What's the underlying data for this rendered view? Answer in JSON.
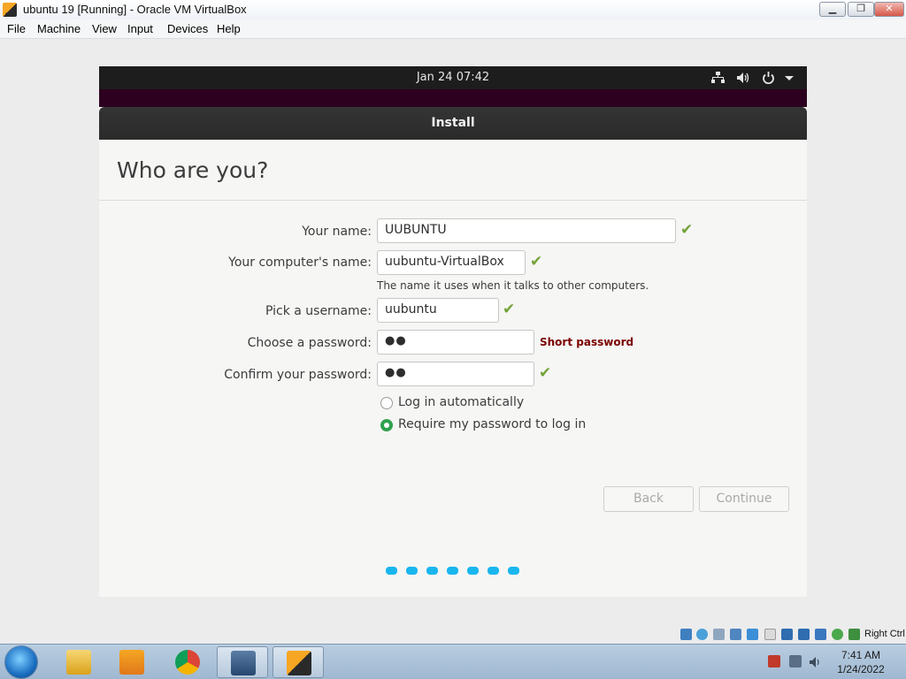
{
  "window": {
    "title": "ubuntu 19 [Running] - Oracle VM VirtualBox",
    "buttons": {
      "minimize": "▁",
      "maximize": "❐",
      "close": "✕"
    }
  },
  "menu": [
    "File",
    "Machine",
    "View",
    "Input",
    "Devices",
    "Help"
  ],
  "guest": {
    "top_bar": {
      "clock": "Jan 24  07:42",
      "icons": [
        "network-icon",
        "volume-icon",
        "power-icon",
        "dropdown-arrow-icon"
      ]
    },
    "installer": {
      "header": "Install",
      "page_title": "Who are you?",
      "fields": {
        "name": {
          "label": "Your name:",
          "value": "UUBUNTU"
        },
        "computer_name": {
          "label": "Your computer's name:",
          "value": "uubuntu-VirtualBox",
          "hint": "The name it uses when it talks to other computers."
        },
        "username": {
          "label": "Pick a username:",
          "value": "uubuntu"
        },
        "password": {
          "label": "Choose a password:",
          "value": "●●",
          "warning": "Short password"
        },
        "confirm_password": {
          "label": "Confirm your password:",
          "value": "●●"
        }
      },
      "login_options": {
        "auto": "Log in automatically",
        "require_password": "Require my password to log in",
        "selected": "require_password"
      },
      "buttons": {
        "back": "Back",
        "continue": "Continue"
      },
      "progress": {
        "steps": 7,
        "accent": "#19b6ee"
      }
    },
    "colors": {
      "top_bar": "#1d1d1d",
      "aubergine": "#2c001e",
      "check": "#73a338",
      "warning": "#7a0000",
      "radio_selected": "#30a14e"
    }
  },
  "vbox_status": {
    "host_key": "Right Ctrl"
  },
  "taskbar": {
    "items": [
      "windows-explorer",
      "media-player",
      "chrome",
      "virtualbox-manager",
      "virtualbox-vm"
    ],
    "clock": {
      "time": "7:41 AM",
      "date": "1/24/2022"
    }
  }
}
